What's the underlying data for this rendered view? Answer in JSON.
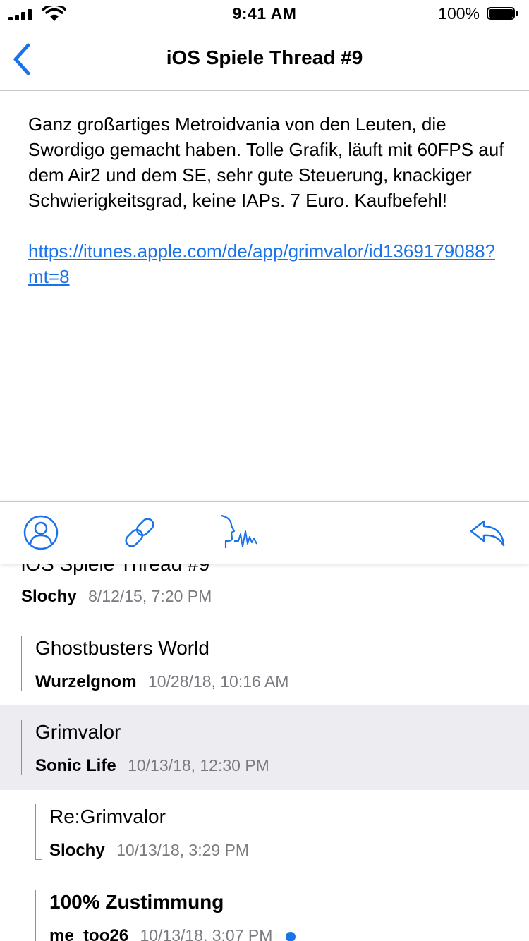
{
  "status_bar": {
    "time": "9:41 AM",
    "battery_percent": "100%"
  },
  "nav": {
    "title": "iOS Spiele Thread #9"
  },
  "post": {
    "body": "Ganz großartiges Metroidvania von den Leuten, die Swordigo gemacht haben. Tolle Grafik, läuft mit 60FPS auf dem Air2 und dem SE, sehr gute Steuerung, knackiger Schwierigkeitsgrad, keine IAPs. 7 Euro. Kaufbefehl!",
    "link": "https://itunes.apple.com/de/app/grimvalor/id1369179088?mt=8"
  },
  "toolbar": {
    "icons": [
      "profile-icon",
      "link-icon",
      "speak-icon",
      "reply-icon"
    ]
  },
  "thread": [
    {
      "title": "iOS Spiele Thread #9",
      "author": "Slochy",
      "date": "8/12/15, 7:20 PM",
      "depth": 0
    },
    {
      "title": "Ghostbusters World",
      "author": "Wurzelgnom",
      "date": "10/28/18, 10:16 AM",
      "depth": 1
    },
    {
      "title": "Grimvalor",
      "author": "Sonic Life",
      "date": "10/13/18, 12:30 PM",
      "depth": 1,
      "selected": true
    },
    {
      "title": "Re:Grimvalor",
      "author": "Slochy",
      "date": "10/13/18, 3:29 PM",
      "depth": 2
    },
    {
      "title": "100% Zustimmung",
      "author": "me_too26",
      "date": "10/13/18, 3:07 PM",
      "depth": 2,
      "unread": true
    }
  ],
  "colors": {
    "accent": "#1a73e8",
    "selected_row": "#ececf1",
    "separator": "#c8c7cc"
  }
}
